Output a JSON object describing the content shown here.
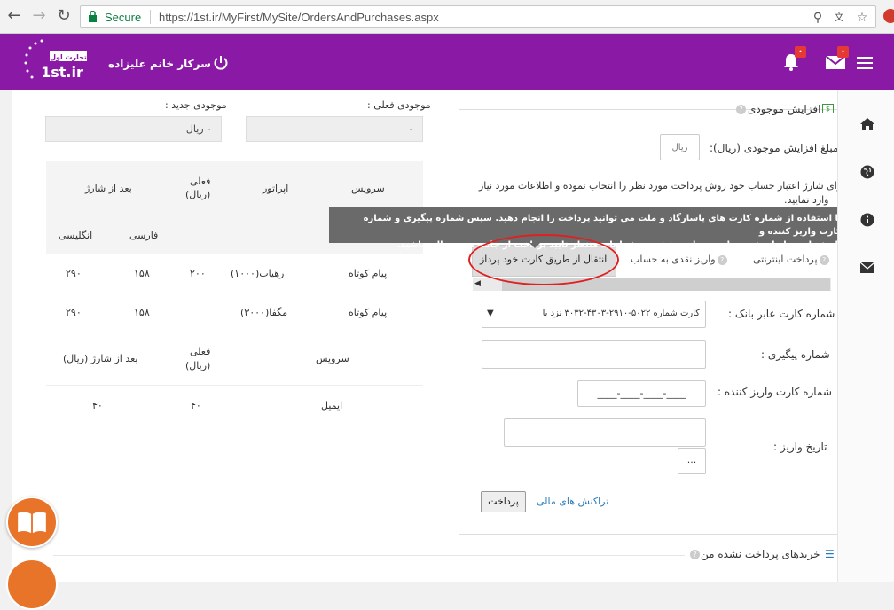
{
  "browser": {
    "secure_label": "Secure",
    "url": "https://1st.ir/MyFirst/MySite/OrdersAndPurchases.aspx"
  },
  "header": {
    "logo_text": "1st.ir",
    "logo_sub": "تجارت اول",
    "greeting": "سرکار خانم علیزاده",
    "bell_badge": "•",
    "mail_badge": "•"
  },
  "balance": {
    "current_label": "موجودی فعلی :",
    "current_value": "۰",
    "new_label": "موجودی جدید :",
    "new_value": "۰ ریال"
  },
  "sms_table": {
    "headers": {
      "service": "سرویس",
      "operator": "اپراتور",
      "current": "فعلی",
      "current_unit": "(ریال)",
      "after": "بعد از شارژ",
      "farsi": "فارسی",
      "english": "انگلیسی"
    },
    "rows": [
      {
        "service": "پیام کوتاه",
        "operator": "رهیاب(۱۰۰۰)",
        "current": "۲۰۰",
        "farsi": "۱۵۸",
        "english": "۲۹۰"
      },
      {
        "service": "پیام کوتاه",
        "operator": "مگفا(۳۰۰۰)",
        "current": "",
        "farsi": "۱۵۸",
        "english": "۲۹۰"
      }
    ]
  },
  "email_table": {
    "headers": {
      "service": "سرویس",
      "current": "فعلی",
      "current_unit": "(ریال)",
      "after": "بعد از شارژ (ریال)"
    },
    "rows": [
      {
        "service": "ایمیل",
        "current": "۴۰",
        "after": "۴۰"
      }
    ]
  },
  "payment": {
    "title": "افزایش موجودی",
    "amount_label": "مبلغ افزایش موجودی (ریال):",
    "amount_placeholder": "ریال",
    "intro_line1": "برای شارژ اعتبار حساب خود روش پرداخت مورد نظر را انتخاب نموده و اطلاعات مورد نیاز",
    "intro_line2": "وارد نمایید.",
    "tabs": [
      "پرداخت اینترنتی",
      "واریز نقدی به حساب",
      "انتقال از طریق کارت خود پرداز"
    ],
    "bank_card_label": "شماره کارت عابر بانک :",
    "bank_card_value": "کارت شماره ۵۰۲۲-۲۹۱۰-۴۳۰۳-۳۰۳۲ نزد با",
    "tracking_label": "شماره پیگیری :",
    "payer_card_label": "شماره کارت واریز کننده :",
    "payer_card_value": "____-____-____-____",
    "date_label": "تاریخ واریز :",
    "date_button": "...",
    "pay_button": "پرداخت",
    "transactions_link": "تراکنش های مالی"
  },
  "tooltip": {
    "line1": "با استفاده از شماره کارت های پاسارگاد و ملت می توانید پرداخت را انجام دهید. سپس شماره پیگیری و شماره کارت واریز کننده و",
    "line2": "تاریخ واریز را وارد ثبت نمایید. در این بخش نیز شما باید منتظر تایید پرداخت از جانب بخش مالی باشید."
  },
  "purchases": {
    "title": "خریدهای پرداخت نشده من"
  },
  "colors": {
    "brand": "#8a1aa6",
    "accent": "#e8742a",
    "secure": "#0b8043"
  }
}
